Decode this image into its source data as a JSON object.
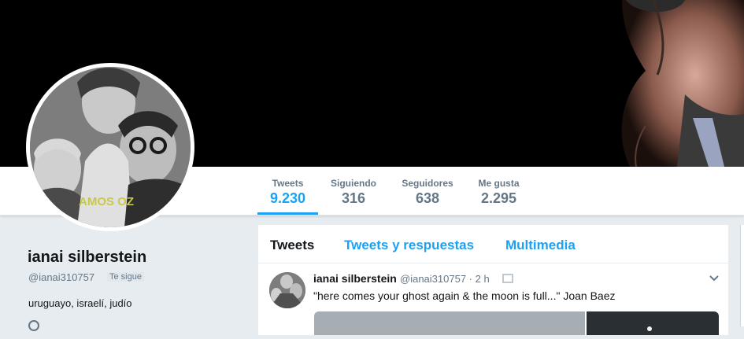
{
  "profile": {
    "name": "ianai silberstein",
    "handle": "@ianai310757",
    "follows_you": "Te sigue",
    "bio": "uruguayo, israelí, judío",
    "avatar_caption": "AMOS OZ"
  },
  "stats": [
    {
      "label": "Tweets",
      "value": "9.230",
      "active": true
    },
    {
      "label": "Siguiendo",
      "value": "316",
      "active": false
    },
    {
      "label": "Seguidores",
      "value": "638",
      "active": false
    },
    {
      "label": "Me gusta",
      "value": "2.295",
      "active": false
    }
  ],
  "timeline": {
    "tabs": [
      "Tweets",
      "Tweets y respuestas",
      "Multimedia"
    ],
    "tweet": {
      "name": "ianai silberstein",
      "meta": "@ianai310757 · 2 h",
      "text": "\"here comes your ghost again & the moon is full...\" Joan Baez"
    }
  },
  "colors": {
    "accent": "#1da1f2",
    "background": "#e6ecf0",
    "text": "#14171a",
    "muted": "#657786"
  },
  "icons": [
    "chevron-down-icon",
    "location-icon",
    "attachment-icon"
  ]
}
